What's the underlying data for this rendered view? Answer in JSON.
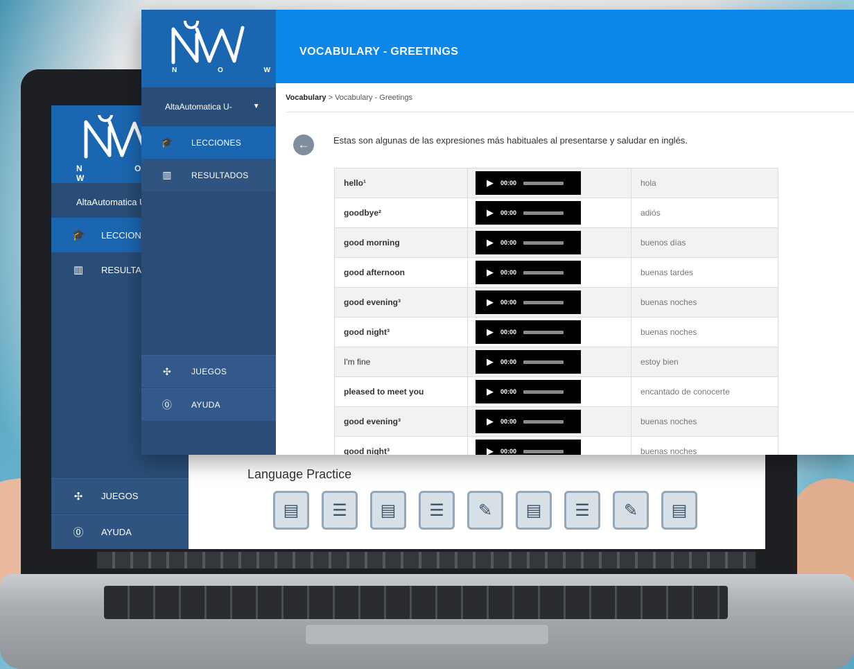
{
  "brand": {
    "logo_letters": "N O W",
    "colors": {
      "primary": "#1b66b0",
      "sidebar": "#2a4d77",
      "header": "#0a87e8"
    }
  },
  "back_screen": {
    "user": "AltaAutomatica U",
    "nav": [
      {
        "label": "LECCION",
        "icon": "graduation-cap-icon"
      },
      {
        "label": "RESULTA",
        "icon": "bar-chart-icon"
      }
    ],
    "bottom_nav": [
      {
        "label": "JUEGOS",
        "icon": "gamepad-icon"
      },
      {
        "label": "AYUDA",
        "icon": "help-icon"
      }
    ],
    "practice_title": "Language Practice",
    "practice_icons": [
      "document-icon",
      "list-icon",
      "document-icon",
      "list-icon",
      "pencil-icon",
      "document-icon",
      "list-icon",
      "pencil-icon",
      "document-icon"
    ]
  },
  "sidebar": {
    "user": "AltaAutomatica U-",
    "nav": [
      {
        "label": "LECCIONES",
        "icon": "graduation-cap-icon"
      },
      {
        "label": "RESULTADOS",
        "icon": "bar-chart-icon"
      }
    ],
    "bottom_nav": [
      {
        "label": "JUEGOS",
        "icon": "gamepad-icon"
      },
      {
        "label": "AYUDA",
        "icon": "help-icon"
      }
    ]
  },
  "header": {
    "title": "VOCABULARY - GREETINGS"
  },
  "breadcrumb": {
    "root": "Vocabulary",
    "separator": ">",
    "current": "Vocabulary - Greetings"
  },
  "intro": "Estas son algunas de las expresiones más habituales al presentarse y saludar en inglés.",
  "player_time": "00:00",
  "vocab": [
    {
      "word": "hello¹",
      "translation": "hola",
      "bold": true
    },
    {
      "word": "goodbye²",
      "translation": "adiós",
      "bold": true
    },
    {
      "word": "good morning",
      "translation": "buenos días",
      "bold": true
    },
    {
      "word": "good afternoon",
      "translation": "buenas tardes",
      "bold": true
    },
    {
      "word": "good evening³",
      "translation": "buenas noches",
      "bold": true
    },
    {
      "word": "good night³",
      "translation": "buenas noches",
      "bold": true
    },
    {
      "word": "I'm fine",
      "translation": "estoy bien",
      "bold": false
    },
    {
      "word": "pleased to meet you",
      "translation": "encantado de conocerte",
      "bold": true
    },
    {
      "word": "good evening³",
      "translation": "buenas noches",
      "bold": true
    },
    {
      "word": "good night³",
      "translation": "buenas noches",
      "bold": true
    }
  ]
}
